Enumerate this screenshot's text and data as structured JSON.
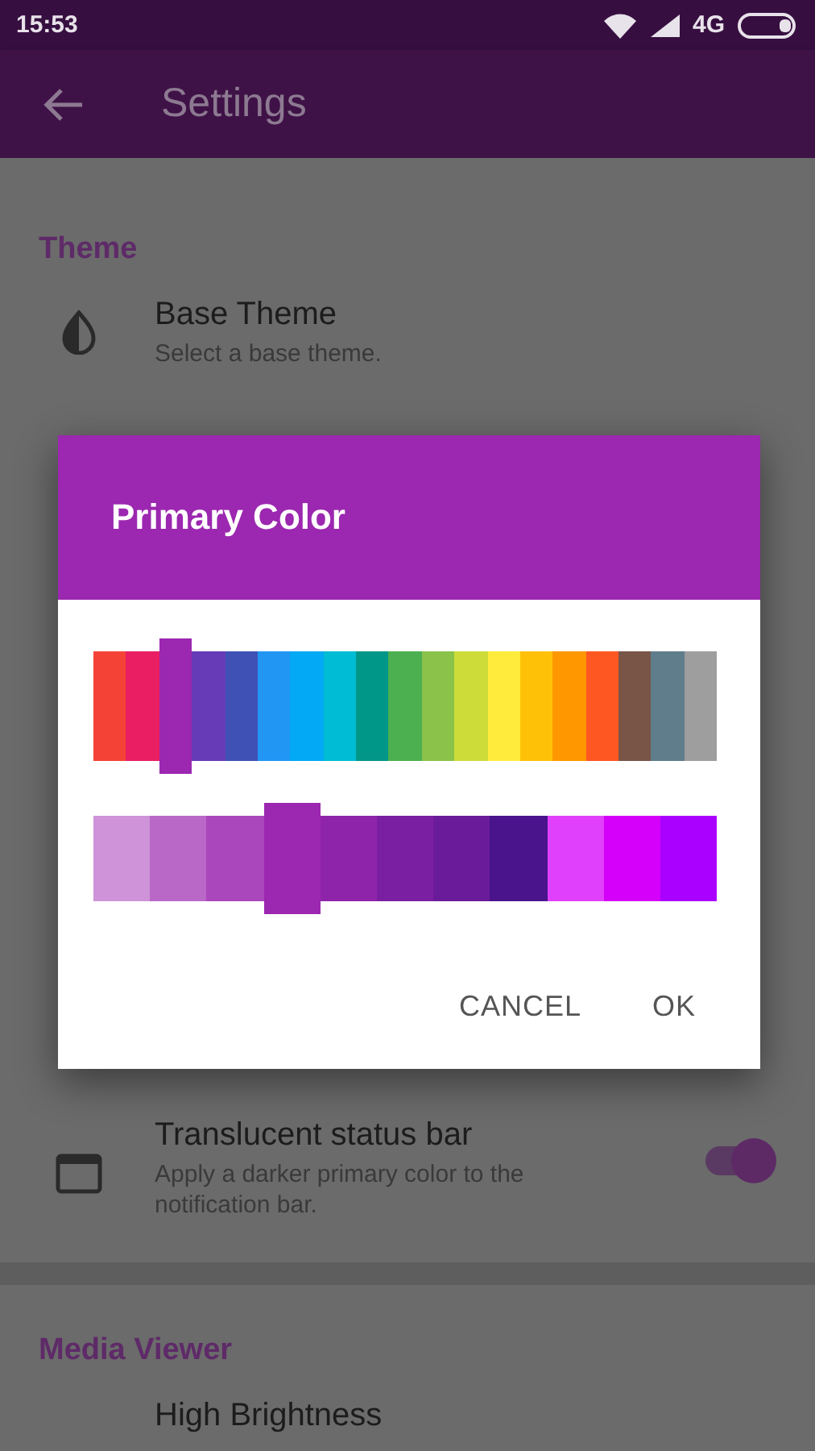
{
  "status_bar": {
    "time": "15:53",
    "network": "4G"
  },
  "app_bar": {
    "title": "Settings"
  },
  "sections": [
    {
      "title": "Theme",
      "items": [
        {
          "kind": "plain",
          "title": "Base Theme",
          "subtitle": "Select a base theme."
        }
      ]
    },
    {
      "items": [
        {
          "kind": "switch",
          "title": "Translucent status bar",
          "subtitle": "Apply a darker primary color to the notification bar.",
          "on": true
        }
      ]
    },
    {
      "title": "Media Viewer",
      "items": [
        {
          "kind": "plain",
          "title": "High Brightness"
        }
      ]
    }
  ],
  "dialog": {
    "title": "Primary Color",
    "palette": [
      {
        "color": "#f44336",
        "selected": false
      },
      {
        "color": "#e91e63",
        "selected": false
      },
      {
        "color": "#9c27b0",
        "selected": true
      },
      {
        "color": "#673ab7",
        "selected": false
      },
      {
        "color": "#3f51b5",
        "selected": false
      },
      {
        "color": "#2196f3",
        "selected": false
      },
      {
        "color": "#03a9f4",
        "selected": false
      },
      {
        "color": "#00bcd4",
        "selected": false
      },
      {
        "color": "#009688",
        "selected": false
      },
      {
        "color": "#4caf50",
        "selected": false
      },
      {
        "color": "#8bc34a",
        "selected": false
      },
      {
        "color": "#cddc39",
        "selected": false
      },
      {
        "color": "#ffeb3b",
        "selected": false
      },
      {
        "color": "#ffc107",
        "selected": false
      },
      {
        "color": "#ff9800",
        "selected": false
      },
      {
        "color": "#ff5722",
        "selected": false
      },
      {
        "color": "#795548",
        "selected": false
      },
      {
        "color": "#607d8b",
        "selected": false
      },
      {
        "color": "#9e9e9e",
        "selected": false
      }
    ],
    "shades": [
      {
        "color": "#ce93d8",
        "selected": false
      },
      {
        "color": "#ba68c8",
        "selected": false
      },
      {
        "color": "#ab47bc",
        "selected": false
      },
      {
        "color": "#9c27b0",
        "selected": true
      },
      {
        "color": "#8e24aa",
        "selected": false
      },
      {
        "color": "#7b1fa2",
        "selected": false
      },
      {
        "color": "#6a1b9a",
        "selected": false
      },
      {
        "color": "#4a148c",
        "selected": false
      },
      {
        "color": "#e040fb",
        "selected": false
      },
      {
        "color": "#d500f9",
        "selected": false
      },
      {
        "color": "#aa00ff",
        "selected": false
      }
    ],
    "buttons": [
      "CANCEL",
      "OK"
    ]
  }
}
